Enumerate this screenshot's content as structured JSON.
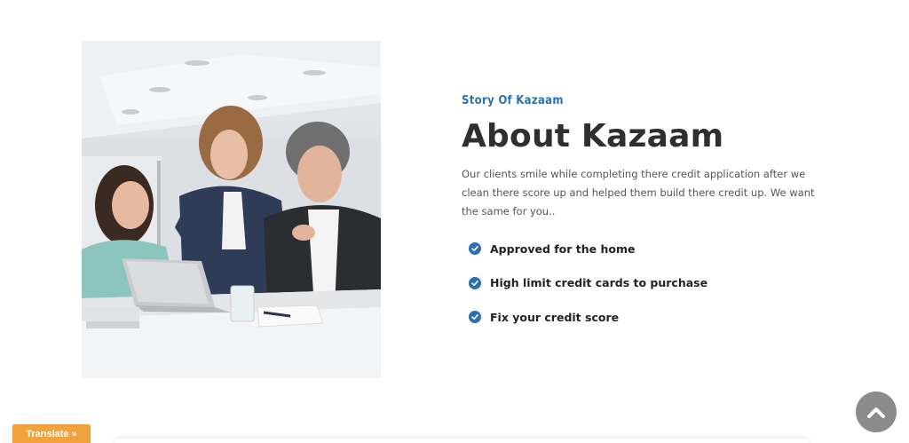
{
  "about": {
    "eyebrow": "Story Of Kazaam",
    "heading": "About Kazaam",
    "body": "Our clients smile while completing there credit application after we clean there score up and helped them build there credit up. We want the same for you..",
    "features": [
      {
        "label": "Approved for the home",
        "icon": "check-circle-icon"
      },
      {
        "label": "High limit credit cards to purchase",
        "icon": "check-circle-icon"
      },
      {
        "label": "Fix your credit score",
        "icon": "check-circle-icon"
      }
    ]
  },
  "widgets": {
    "translate_label": "Translate »",
    "scroll_top_icon": "chevron-up-icon"
  },
  "colors": {
    "accent": "#2f6fad",
    "translate_bg": "#f2a23a",
    "scroll_top_bg": "#8b8b8b"
  }
}
